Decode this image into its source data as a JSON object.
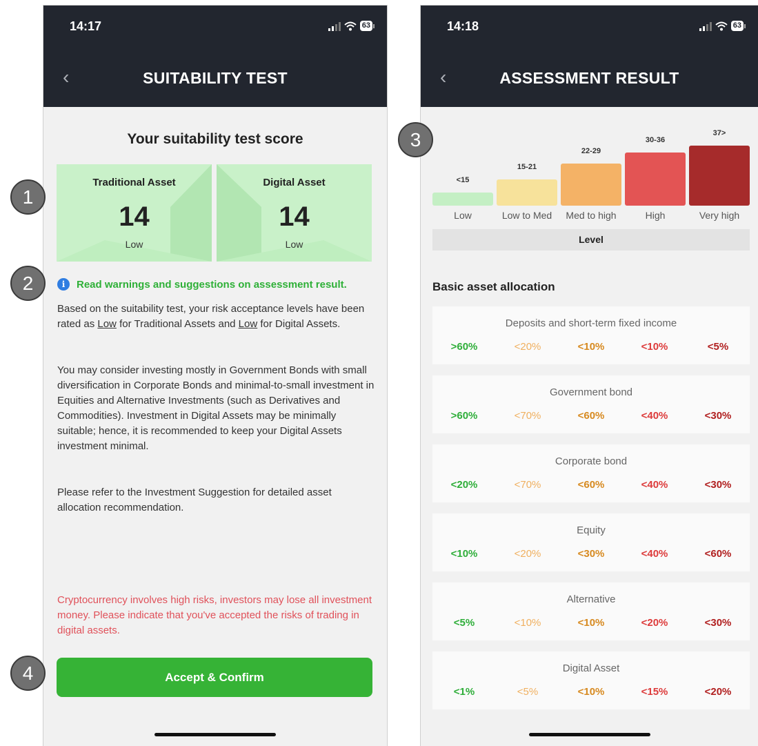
{
  "left": {
    "status": {
      "time": "14:17",
      "battery": "63"
    },
    "title": "SUITABILITY TEST",
    "score_heading": "Your suitability test score",
    "traditional": {
      "label": "Traditional Asset",
      "score": "14",
      "level": "Low"
    },
    "digital": {
      "label": "Digital Asset",
      "score": "14",
      "level": "Low"
    },
    "warning_link": "Read warnings and suggestions on assessment result.",
    "para1": {
      "p1": "Based on the suitability test, your risk acceptance levels have been rated as ",
      "u1": "Low",
      "p2": " for Traditional Assets and ",
      "u2": "Low",
      "p3": " for Digital Assets."
    },
    "para2": "You may consider investing mostly in Government Bonds with small diversification in Corporate Bonds and minimal-to-small investment in Equities and Alternative Investments (such as Derivatives and Commodities). Investment in Digital Assets may be minimally suitable; hence, it is recommended to keep your Digital Assets investment minimal.",
    "para3": "Please refer to the Investment Suggestion for detailed asset allocation recommendation.",
    "risk_warning": "Cryptocurrency involves high risks, investors may lose all investment money. Please indicate that you've accepted the risks of trading in digital assets.",
    "accept_label": "Accept & Confirm"
  },
  "right": {
    "status": {
      "time": "14:18",
      "battery": "63"
    },
    "title": "ASSESSMENT RESULT",
    "levels": [
      {
        "range": "<15",
        "name": "Low",
        "height_pct": 0.22,
        "color": "#c4efc4"
      },
      {
        "range": "15-21",
        "name": "Low to Med",
        "height_pct": 0.44,
        "color": "#f7e29b"
      },
      {
        "range": "22-29",
        "name": "Med to high",
        "height_pct": 0.7,
        "color": "#f4b266"
      },
      {
        "range": "30-36",
        "name": "High",
        "height_pct": 0.88,
        "color": "#e35454"
      },
      {
        "range": "37>",
        "name": "Very high",
        "height_pct": 1.0,
        "color": "#a62b2b"
      }
    ],
    "level_label": "Level",
    "allocation_heading": "Basic asset allocation",
    "allocations": [
      {
        "name": "Deposits and short-term fixed income",
        "values": [
          ">60%",
          "<20%",
          "<10%",
          "<10%",
          "<5%"
        ]
      },
      {
        "name": "Government bond",
        "values": [
          ">60%",
          "<70%",
          "<60%",
          "<40%",
          "<30%"
        ]
      },
      {
        "name": "Corporate bond",
        "values": [
          "<20%",
          "<70%",
          "<60%",
          "<40%",
          "<30%"
        ]
      },
      {
        "name": "Equity",
        "values": [
          "<10%",
          "<20%",
          "<30%",
          "<40%",
          "<60%"
        ]
      },
      {
        "name": "Alternative",
        "values": [
          "<5%",
          "<10%",
          "<10%",
          "<20%",
          "<30%"
        ]
      },
      {
        "name": "Digital Asset",
        "values": [
          "<1%",
          "<5%",
          "<10%",
          "<15%",
          "<20%"
        ]
      }
    ],
    "value_colors": [
      "#2fae3a",
      "#f0b060",
      "#d78a20",
      "#dd3b3b",
      "#b12020"
    ]
  },
  "callouts": [
    "1",
    "2",
    "3",
    "4"
  ]
}
